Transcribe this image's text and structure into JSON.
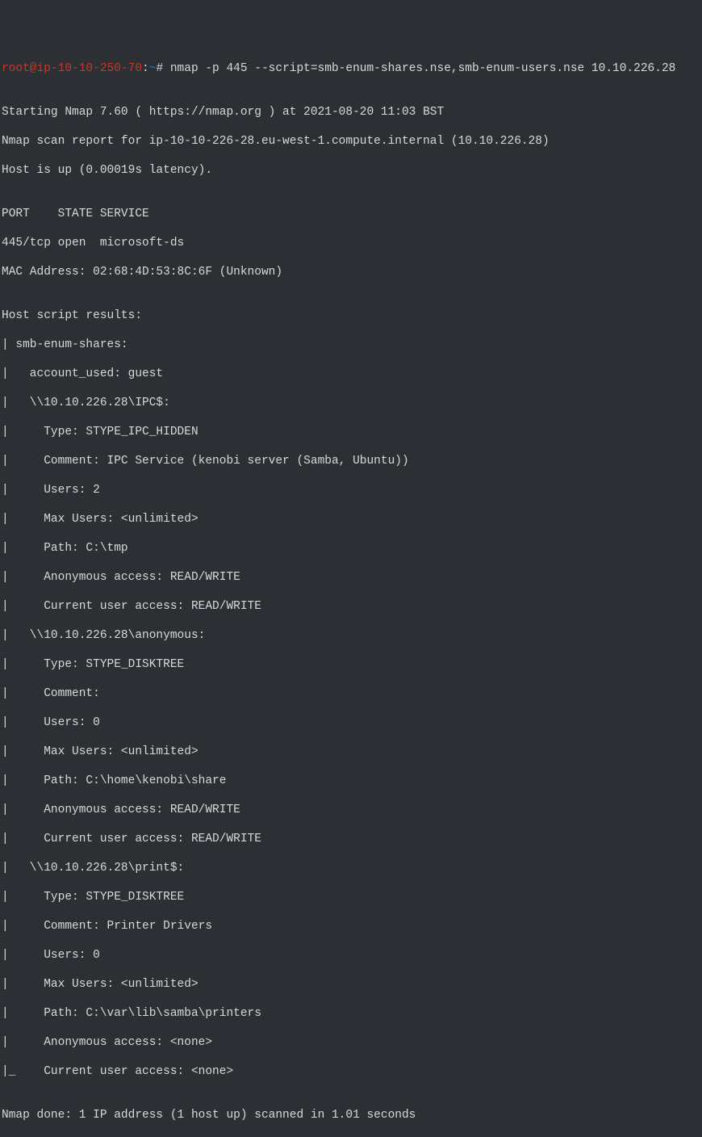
{
  "prompt": {
    "user": "root@ip-10-10-250-70",
    "sep": ":",
    "path": "~",
    "hash": "#",
    "command": "nmap -p 445 --script=smb-enum-shares.nse,smb-enum-users.nse 10.10.226.28"
  },
  "lines": {
    "blank": "",
    "l01": "Starting Nmap 7.60 ( https://nmap.org ) at 2021-08-20 11:03 BST",
    "l02": "Nmap scan report for ip-10-10-226-28.eu-west-1.compute.internal (10.10.226.28)",
    "l03": "Host is up (0.00019s latency).",
    "l04": "PORT    STATE SERVICE",
    "l05": "445/tcp open  microsoft-ds",
    "l06": "MAC Address: 02:68:4D:53:8C:6F (Unknown)",
    "l07": "Host script results:",
    "l08": "| smb-enum-shares: ",
    "l09": "|   account_used: guest",
    "l10": "|   \\\\10.10.226.28\\IPC$: ",
    "l11": "|     Type: STYPE_IPC_HIDDEN",
    "l12": "|     Comment: IPC Service (kenobi server (Samba, Ubuntu))",
    "l13": "|     Users: 2",
    "l14": "|     Max Users: <unlimited>",
    "l15": "|     Path: C:\\tmp",
    "l16": "|     Anonymous access: READ/WRITE",
    "l17": "|     Current user access: READ/WRITE",
    "l18": "|   \\\\10.10.226.28\\anonymous: ",
    "l19": "|     Type: STYPE_DISKTREE",
    "l20": "|     Comment: ",
    "l21": "|     Users: 0",
    "l22": "|     Max Users: <unlimited>",
    "l23": "|     Path: C:\\home\\kenobi\\share",
    "l24": "|     Anonymous access: READ/WRITE",
    "l25": "|     Current user access: READ/WRITE",
    "l26": "|   \\\\10.10.226.28\\print$: ",
    "l27": "|     Type: STYPE_DISKTREE",
    "l28": "|     Comment: Printer Drivers",
    "l29": "|     Users: 0",
    "l30": "|     Max Users: <unlimited>",
    "l31": "|     Path: C:\\var\\lib\\samba\\printers",
    "l32": "|     Anonymous access: <none>",
    "l33": "|_    Current user access: <none>",
    "l34": "Nmap done: 1 IP address (1 host up) scanned in 1.01 seconds"
  }
}
